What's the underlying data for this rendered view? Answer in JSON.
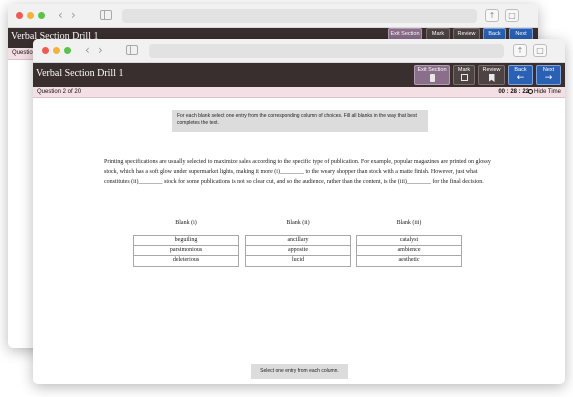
{
  "back_window": {
    "title": "Verbal Section Drill 1",
    "toolbar": {
      "exit_section": "Exit Section",
      "mark": "Mark",
      "review": "Review",
      "back": "Back",
      "next": "Next"
    },
    "question_bar": "Question"
  },
  "front_window": {
    "title": "Verbal Section Drill 1",
    "toolbar": {
      "exit_section": "Exit Section",
      "mark": "Mark",
      "review": "Review",
      "back": "Back",
      "next": "Next"
    },
    "question_bar": {
      "position": "Question 2 of 20",
      "timer": "00 : 28 : 22",
      "hide_time": "Hide Time"
    },
    "instructions": "For each blank select one entry from the corresponding column of choices. Fill all blanks in the way that best completes the text.",
    "passage": "Printing specifications are usually selected to maximize sales according to the specific type of publication. For example, popular magazines are printed on glossy stock, which has a soft glow under supermarket lights, making it more (i)________ to the weary shopper than stock with a matte finish. However, just what constitutes (ii)________ stock for some publications is not so clear cut, and so the audience, rather than the content, is the (iii)________ for the final decision.",
    "blanks": [
      {
        "header": "Blank (i)",
        "choices": [
          "beguiling",
          "parsimonious",
          "deleterious"
        ]
      },
      {
        "header": "Blank (ii)",
        "choices": [
          "ancillary",
          "apposite",
          "lucid"
        ]
      },
      {
        "header": "Blank (iii)",
        "choices": [
          "catalyst",
          "ambience",
          "aesthetic"
        ]
      }
    ],
    "status": "Select one entry from each column."
  },
  "browser": {
    "nav_back": "‹",
    "nav_forward": "›",
    "share_glyph": "↑",
    "tabs_glyph": "□"
  },
  "icons": [
    "calculator-icon",
    "checkbox-icon",
    "bookmark-icon",
    "left-arrow-icon",
    "right-arrow-icon",
    "clock-icon"
  ],
  "colors": {
    "app_bar": "#3a2f2f",
    "question_bar": "#f4dfe5",
    "nav_button": "#2a61b4",
    "exit_button": "#8a6e8a"
  }
}
